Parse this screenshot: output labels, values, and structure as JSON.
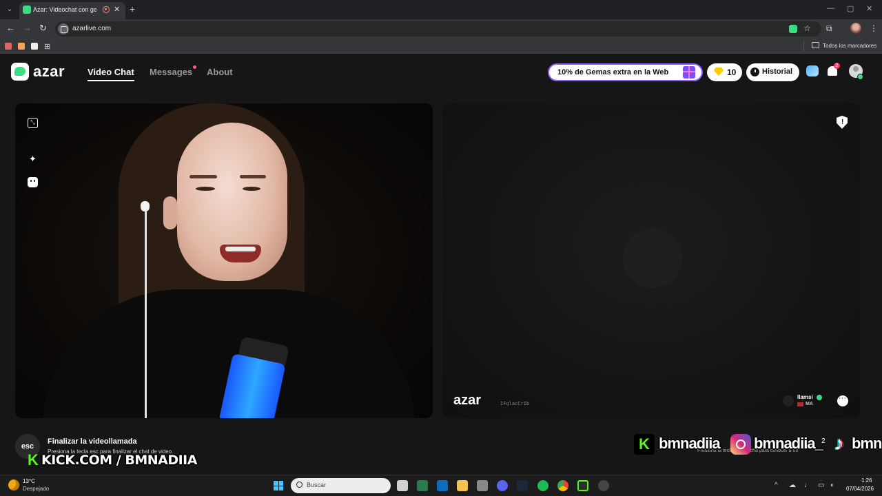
{
  "browser": {
    "tab_title": "Azar: Videochat con gente",
    "url": "azarlive.com",
    "bookmarks_all": "Todos los marcadores",
    "bookmark_colors": [
      "#e06666",
      "#f6a35b",
      "#eeeeee"
    ]
  },
  "header": {
    "brand": "azar",
    "nav": [
      "Video Chat",
      "Messages",
      "About"
    ],
    "active_nav": "Video Chat",
    "promo": "10% de Gemas extra en la Web",
    "gems": "10",
    "history": "Historial",
    "notification_count": "2",
    "accent": "#3ddc84"
  },
  "remote": {
    "watermark_brand": "azar",
    "watermark_code": "IFqlacCrIb",
    "peer_name": "llamsi",
    "peer_country": "MA"
  },
  "hints": {
    "esc_key": "esc",
    "end_title": "Finalizar la videollamada",
    "end_sub": "Presiona la tecla esc para finalizar el chat de video.",
    "next_hint": "Presiona la tecla → derecha para conocer a otr",
    "next_num": "2"
  },
  "overlay": {
    "kick_text": "KICK.COM / BMNADIIA",
    "social_names": [
      "bmnadiia",
      "bmnadiia_",
      "bmn"
    ]
  },
  "taskbar": {
    "temperature": "13°C",
    "weather": "Despejado",
    "search_placeholder": "Buscar",
    "time": "1:26",
    "date": "07/04/2026"
  }
}
